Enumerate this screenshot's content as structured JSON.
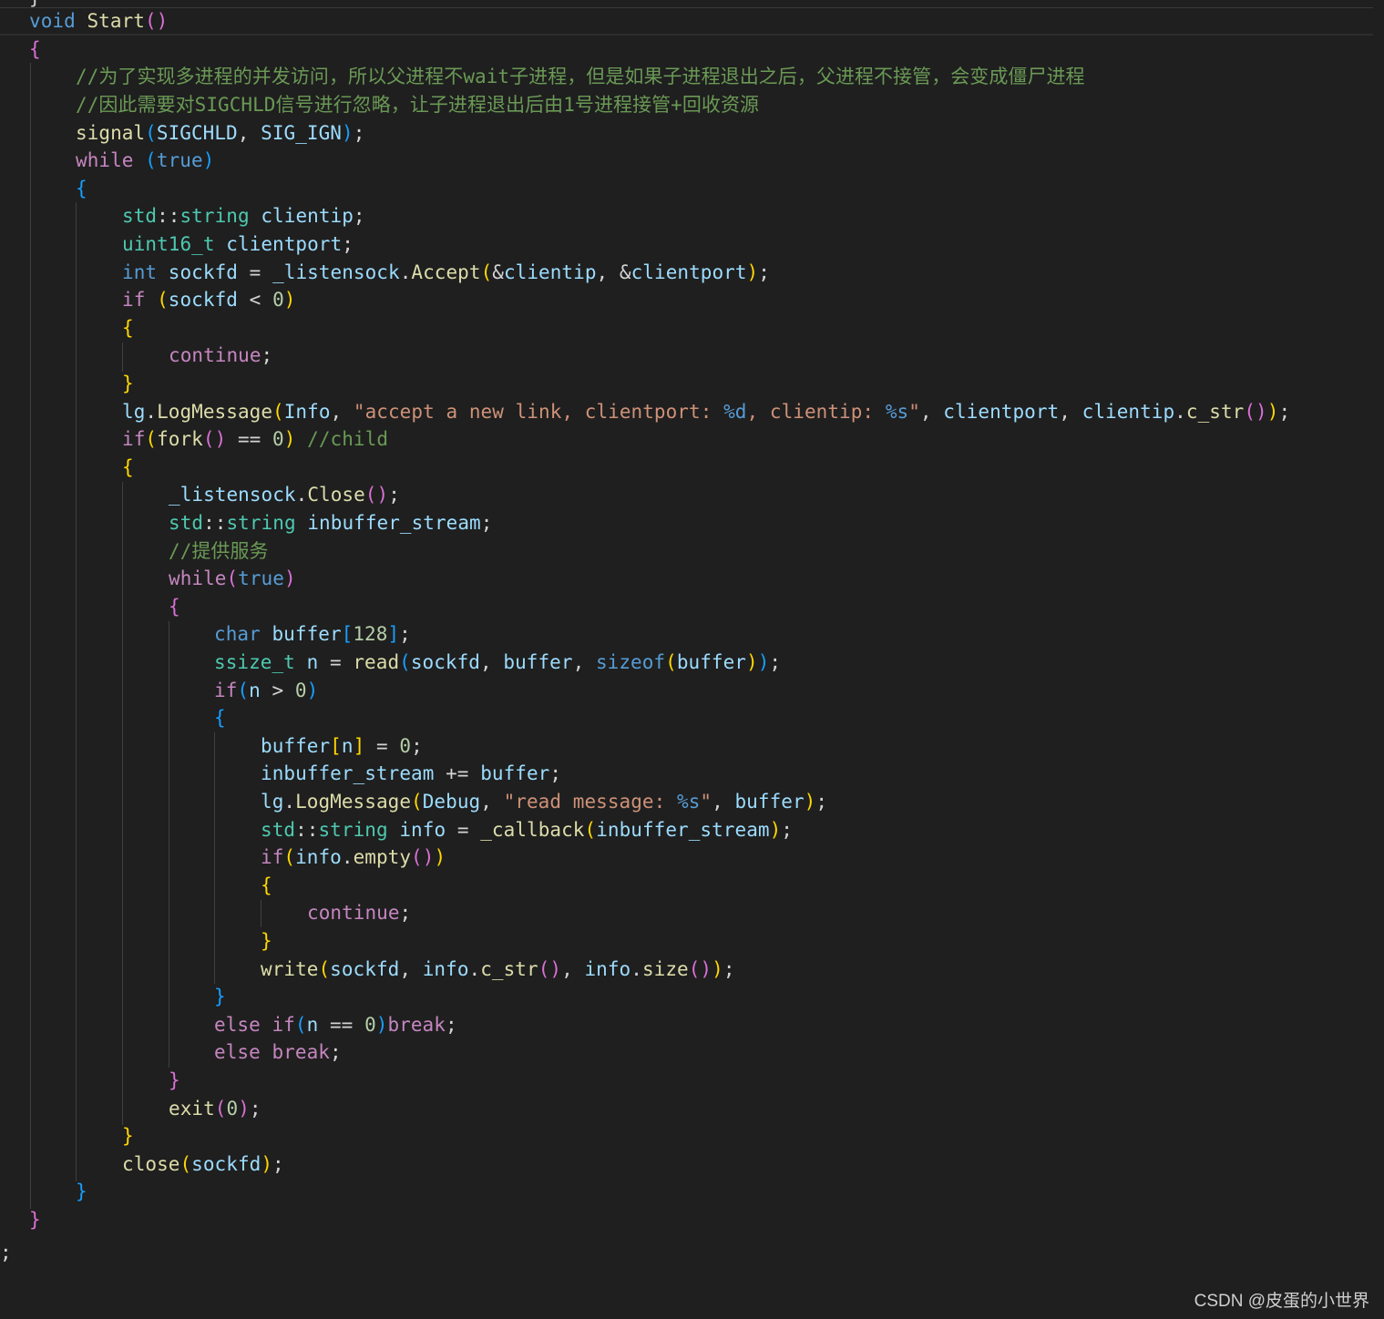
{
  "code": {
    "func_keyword": "void",
    "func_name": "Start",
    "comment_1": "//为了实现多进程的并发访问，所以父进程不wait子进程，但是如果子进程退出之后，父进程不接管，会变成僵尸进程",
    "comment_2": "//因此需要对SIGCHLD信号进行忽略，让子进程退出后由1号进程接管+回收资源",
    "signal_fn": "signal",
    "sigchld": "SIGCHLD",
    "sig_ign": "SIG_IGN",
    "while_kw": "while",
    "true_kw": "true",
    "std_ns": "std",
    "string_type": "string",
    "clientip_var": "clientip",
    "uint16_type": "uint16_t",
    "clientport_var": "clientport",
    "int_type": "int",
    "sockfd_var": "sockfd",
    "listensock_var": "_listensock",
    "accept_fn": "Accept",
    "if_kw": "if",
    "zero": "0",
    "continue_kw": "continue",
    "lg_var": "lg",
    "logmessage_fn": "LogMessage",
    "info_level": "Info",
    "log_str_1a": "\"accept a new link, clientport: ",
    "fmt_d": "%d",
    "log_str_1b": ", clientip: ",
    "fmt_s": "%s",
    "quote": "\"",
    "c_str_fn": "c_str",
    "fork_fn": "fork",
    "child_comment": "//child",
    "close_method": "Close",
    "inbuffer_var": "inbuffer_stream",
    "service_comment": "//提供服务",
    "char_type": "char",
    "buffer_var": "buffer",
    "buffer_size": "128",
    "ssize_type": "ssize_t",
    "n_var": "n",
    "read_fn": "read",
    "sizeof_kw": "sizeof",
    "debug_level": "Debug",
    "log_str_2a": "\"read message: ",
    "info_var": "info",
    "callback_fn": "_callback",
    "empty_fn": "empty",
    "write_fn": "write",
    "size_fn": "size",
    "else_kw": "else",
    "break_kw": "break",
    "exit_fn": "exit",
    "close_fn": "close"
  },
  "watermark": "CSDN @皮蛋的小世界",
  "colors": {
    "background": "#1f1f1f",
    "keyword": "#569cd6",
    "control": "#c586c0",
    "function": "#dcdcaa",
    "variable": "#9cdcfe",
    "type": "#4ec9b0",
    "string": "#ce9178",
    "number": "#b5cea8",
    "comment": "#6a9955",
    "bracket_gold": "#ffd700",
    "bracket_orchid": "#da70d6",
    "bracket_blue": "#179fff"
  }
}
